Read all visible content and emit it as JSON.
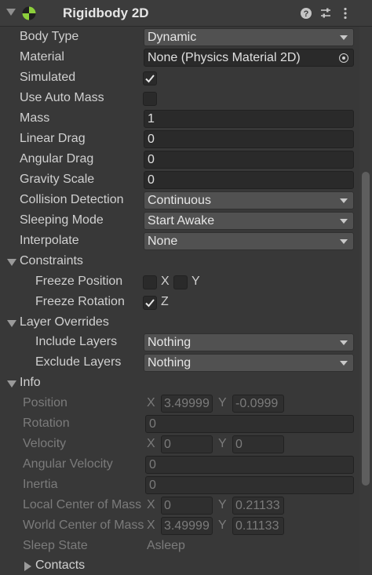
{
  "component": {
    "title": "Rigidbody 2D",
    "icons": [
      "rigidbody2d-icon",
      "help-icon",
      "presets-icon",
      "more-icon"
    ]
  },
  "properties": {
    "body_type": {
      "label": "Body Type",
      "value": "Dynamic"
    },
    "material": {
      "label": "Material",
      "value": "None (Physics Material 2D)"
    },
    "simulated": {
      "label": "Simulated",
      "checked": true
    },
    "use_auto_mass": {
      "label": "Use Auto Mass",
      "checked": false
    },
    "mass": {
      "label": "Mass",
      "value": "1"
    },
    "linear_drag": {
      "label": "Linear Drag",
      "value": "0"
    },
    "angular_drag": {
      "label": "Angular Drag",
      "value": "0"
    },
    "gravity_scale": {
      "label": "Gravity Scale",
      "value": "0"
    },
    "collision_detection": {
      "label": "Collision Detection",
      "value": "Continuous"
    },
    "sleeping_mode": {
      "label": "Sleeping Mode",
      "value": "Start Awake"
    },
    "interpolate": {
      "label": "Interpolate",
      "value": "None"
    }
  },
  "constraints": {
    "label": "Constraints",
    "freeze_position": {
      "label": "Freeze Position",
      "x_label": "X",
      "y_label": "Y",
      "x": false,
      "y": false
    },
    "freeze_rotation": {
      "label": "Freeze Rotation",
      "z_label": "Z",
      "z": true
    }
  },
  "layer_overrides": {
    "label": "Layer Overrides",
    "include_layers": {
      "label": "Include Layers",
      "value": "Nothing"
    },
    "exclude_layers": {
      "label": "Exclude Layers",
      "value": "Nothing"
    }
  },
  "info": {
    "label": "Info",
    "position": {
      "label": "Position",
      "x_label": "X",
      "x": "3.49999",
      "y_label": "Y",
      "y": "-0.0999"
    },
    "rotation": {
      "label": "Rotation",
      "value": "0"
    },
    "velocity": {
      "label": "Velocity",
      "x_label": "X",
      "x": "0",
      "y_label": "Y",
      "y": "0"
    },
    "angular_velocity": {
      "label": "Angular Velocity",
      "value": "0"
    },
    "inertia": {
      "label": "Inertia",
      "value": "0"
    },
    "local_center_of_mass": {
      "label": "Local Center of Mass",
      "x_label": "X",
      "x": "0",
      "y_label": "Y",
      "y": "0.21133"
    },
    "world_center_of_mass": {
      "label": "World Center of Mass",
      "x_label": "X",
      "x": "3.49999",
      "y_label": "Y",
      "y": "0.11133"
    },
    "sleep_state": {
      "label": "Sleep State",
      "value": "Asleep"
    },
    "contacts": {
      "label": "Contacts"
    }
  }
}
